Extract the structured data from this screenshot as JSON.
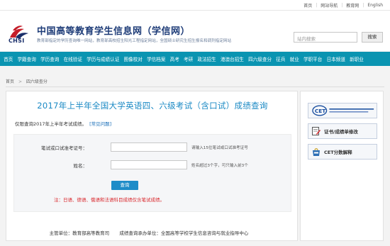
{
  "topbar": {
    "links": [
      "首页",
      "网站导航",
      "教育网",
      "English"
    ]
  },
  "header": {
    "logo_text": "CHSI",
    "title": "中国高等教育学生信息网（学信网）",
    "description": "教育部指定的学历查询唯一网站，教育部高校招生阳光工程指定网站，全国硕士研究生招生报名和调剂指定网站",
    "search_placeholder": "站内搜索",
    "search_button": "搜索"
  },
  "nav": {
    "items": [
      "首页",
      "学籍查询",
      "学历查询",
      "在线验证",
      "学历与成绩认证",
      "图像校对",
      "学信档案",
      "高考",
      "考研",
      "政法招生",
      "港澳台招生",
      "四六级查分",
      "征兵",
      "就业",
      "学职平台",
      "日本频道",
      "新职业"
    ]
  },
  "breadcrumb": {
    "items": [
      "首页",
      "四六级查分"
    ]
  },
  "main": {
    "title": "2017年上半年全国大学英语四、六级考试（含口试）成绩查询",
    "notice": "仅限查询2017年上半年考试成绩。",
    "faq_link": "[常见问题]",
    "form": {
      "ticket_label": "笔试或口试准考证号：",
      "ticket_value": "",
      "ticket_hint": "请输入15位笔试或口试准考证号",
      "name_label": "姓名：",
      "name_value": "",
      "name_hint": "姓名超过3个字，可只输入前3个",
      "submit_label": "查询",
      "note": "注：日语、德语、俄语和法语科目成绩仅含笔试成绩。"
    }
  },
  "sidebar": {
    "cards": [
      {
        "icon": "cet-logo-icon",
        "label": ""
      },
      {
        "icon": "edit-form-icon",
        "label": "证书/成绩单修改"
      },
      {
        "icon": "cet-bag-icon",
        "label": "CET分数解释"
      }
    ]
  },
  "footer": {
    "supervisor": "主管单位：教育部高等教育司",
    "undertaker": "成绩查询承办单位：全国高等学校学生信息咨询与就业指导中心"
  },
  "colors": {
    "nav_bg": "#0a94b1",
    "title": "#1a89c4",
    "submit_bg": "#1e8cc8",
    "note": "#d9262b"
  }
}
